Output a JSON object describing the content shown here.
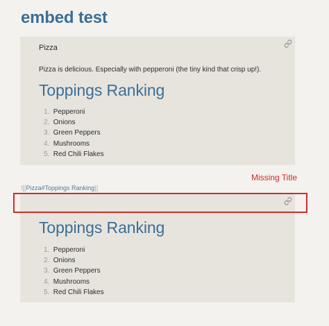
{
  "page": {
    "title": "embed test"
  },
  "embed1": {
    "heading": "Pizza",
    "paragraph": "Pizza is delicious. Especially with pepperoni (the tiny kind that crisp up!).",
    "section_heading": "Toppings Ranking",
    "list": [
      {
        "num": "1.",
        "text": "Pepperoni"
      },
      {
        "num": "2.",
        "text": "Onions"
      },
      {
        "num": "3.",
        "text": "Green Peppers"
      },
      {
        "num": "4.",
        "text": "Mushrooms"
      },
      {
        "num": "5.",
        "text": "Red Chili Flakes"
      }
    ],
    "link_icon": "link-icon"
  },
  "embed_ref": {
    "open": "![[",
    "text": "Pizza#Toppings Ranking",
    "close": "]]"
  },
  "annotation": {
    "label": "Missing Title",
    "color": "#d02b2b"
  },
  "embed2": {
    "section_heading": "Toppings Ranking",
    "list": [
      {
        "num": "1.",
        "text": "Pepperoni"
      },
      {
        "num": "2.",
        "text": "Onions"
      },
      {
        "num": "3.",
        "text": "Green Peppers"
      },
      {
        "num": "4.",
        "text": "Mushrooms"
      },
      {
        "num": "5.",
        "text": "Red Chili Flakes"
      }
    ],
    "link_icon": "link-icon"
  },
  "colors": {
    "accent": "#3a6f96",
    "embed_bg": "#e7e4de",
    "page_bg": "#f4f2ee"
  }
}
